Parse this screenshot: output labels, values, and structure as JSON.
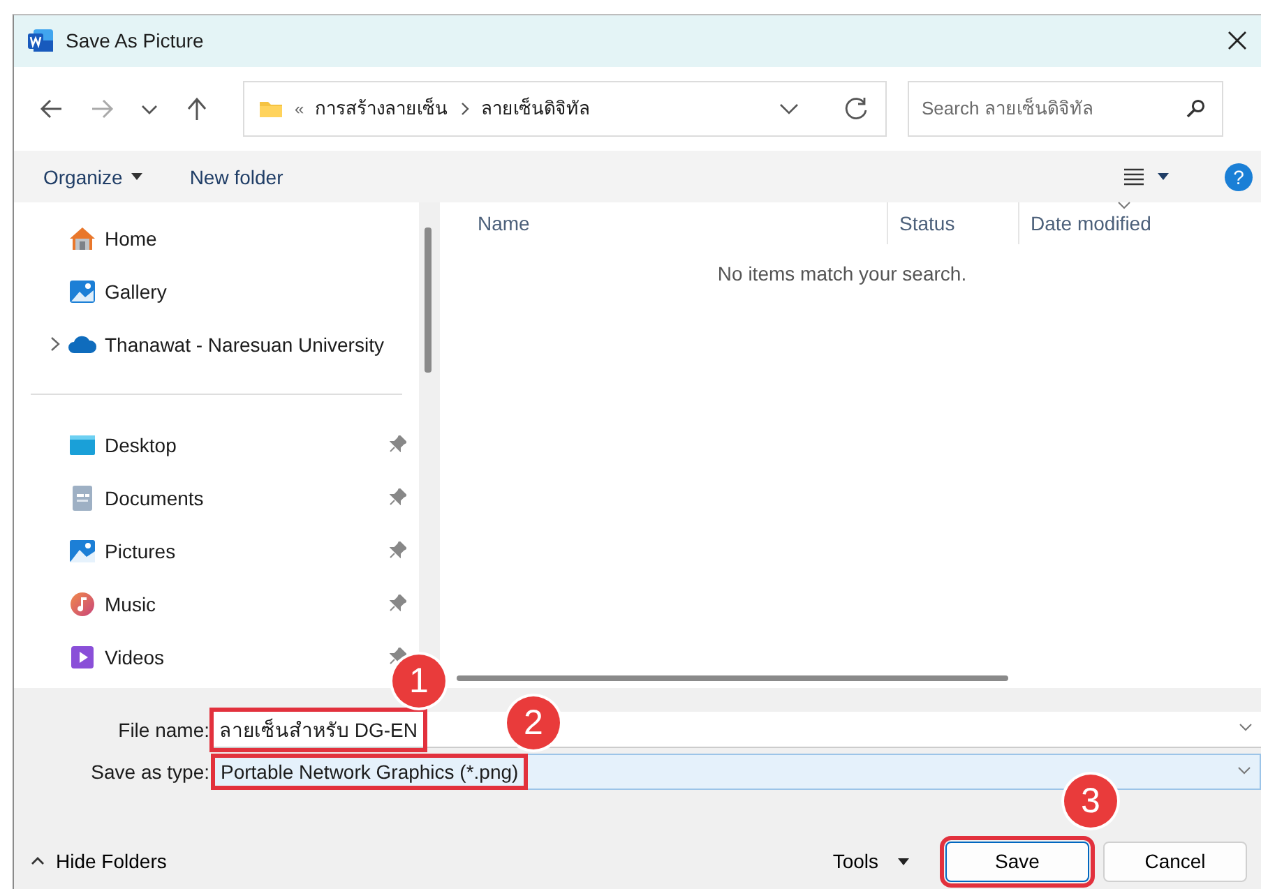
{
  "window": {
    "title": "Save As Picture"
  },
  "nav": {
    "path_prefix": "«",
    "breadcrumbs": [
      "การสร้างลายเซ็น",
      "ลายเซ็นดิจิทัล"
    ],
    "search_placeholder": "Search ลายเซ็นดิจิทัล"
  },
  "commands": {
    "organize": "Organize",
    "new_folder": "New folder",
    "help": "?"
  },
  "sidebar": {
    "groups": [
      [
        {
          "label": "Home",
          "kind": "home",
          "expandable": false,
          "pinned": false
        },
        {
          "label": "Gallery",
          "kind": "gallery",
          "expandable": false,
          "pinned": false
        },
        {
          "label": "Thanawat - Naresuan University",
          "kind": "cloud",
          "expandable": true,
          "pinned": false
        }
      ],
      [
        {
          "label": "Desktop",
          "kind": "desktop",
          "expandable": false,
          "pinned": true
        },
        {
          "label": "Documents",
          "kind": "documents",
          "expandable": false,
          "pinned": true
        },
        {
          "label": "Pictures",
          "kind": "pictures",
          "expandable": false,
          "pinned": true
        },
        {
          "label": "Music",
          "kind": "music",
          "expandable": false,
          "pinned": true
        },
        {
          "label": "Videos",
          "kind": "videos",
          "expandable": false,
          "pinned": true
        }
      ]
    ]
  },
  "file_list": {
    "columns": [
      {
        "label": "Name",
        "sorted": false
      },
      {
        "label": "Status",
        "sorted": false
      },
      {
        "label": "Date modified",
        "sorted": true
      }
    ],
    "empty_message": "No items match your search."
  },
  "fields": [
    {
      "label": "File name:",
      "value": "ลายเซ็นสำหรับ DG-EN",
      "highlighted": true,
      "annotation": "1"
    },
    {
      "label": "Save as type:",
      "value": "Portable Network Graphics (*.png)",
      "highlighted": true,
      "annotation": "2"
    }
  ],
  "footer": {
    "hide_folders": "Hide Folders",
    "tools": "Tools",
    "buttons": [
      {
        "label": "Save",
        "primary": true,
        "highlighted": true,
        "annotation": "3"
      },
      {
        "label": "Cancel",
        "primary": false,
        "highlighted": false
      }
    ]
  }
}
